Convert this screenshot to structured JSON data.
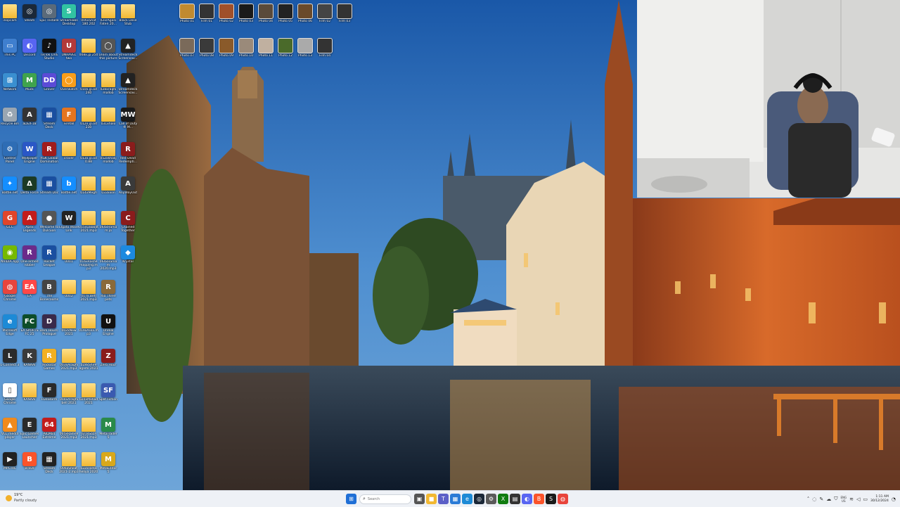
{
  "desktop": {
    "columns": [
      [
        {
          "label": "inopcam",
          "kind": "folder"
        },
        {
          "label": "This PC",
          "kind": "app",
          "color": "#3f7fcf",
          "glyph": "▭"
        },
        {
          "label": "Network",
          "kind": "app",
          "color": "#3a8fd0",
          "glyph": "⊞"
        },
        {
          "label": "Recycle Bin",
          "kind": "app",
          "color": "#9aa6b2",
          "glyph": "♻"
        },
        {
          "label": "Control Panel",
          "kind": "app",
          "color": "#2e6db5",
          "glyph": "⚙"
        },
        {
          "label": "Battle.net",
          "kind": "app",
          "color": "#148eff",
          "glyph": "✦"
        },
        {
          "label": "GCC",
          "kind": "app",
          "color": "#e0452a",
          "glyph": "G"
        },
        {
          "label": "NVIDIA App",
          "kind": "app",
          "color": "#76b900",
          "glyph": "◉"
        },
        {
          "label": "Google Chrome",
          "kind": "app",
          "color": "#e8453c",
          "glyph": "◍"
        },
        {
          "label": "Microsoft Edge",
          "kind": "app",
          "color": "#1d8ad6",
          "glyph": "e"
        },
        {
          "label": "L-Connect 3",
          "kind": "app",
          "color": "#2b2b2b",
          "glyph": "L"
        },
        {
          "label": "Google Chrome",
          "kind": "app",
          "color": "#ffffff",
          "glyph": "▯"
        },
        {
          "label": "VLC media player",
          "kind": "app",
          "color": "#f08a1c",
          "glyph": "▲"
        },
        {
          "label": "MPC-HC",
          "kind": "app",
          "color": "#222222",
          "glyph": "▶"
        }
      ],
      [
        {
          "label": "Steam",
          "kind": "app",
          "color": "#1b2838",
          "glyph": "◎"
        },
        {
          "label": "Discord",
          "kind": "app",
          "color": "#5865f2",
          "glyph": "◐"
        },
        {
          "label": "Muck",
          "kind": "app",
          "color": "#3fa34d",
          "glyph": "M"
        },
        {
          "label": "aDEX-18",
          "kind": "app",
          "color": "#333333",
          "glyph": "A"
        },
        {
          "label": "Wallpaper Engine",
          "kind": "app",
          "color": "#2a57c6",
          "glyph": "W"
        },
        {
          "label": "Delta Force",
          "kind": "app",
          "color": "#1c3a25",
          "glyph": "Δ"
        },
        {
          "label": "Apex Legends",
          "kind": "app",
          "color": "#c21c1c",
          "glyph": "A"
        },
        {
          "label": "One-armed robber",
          "kind": "app",
          "color": "#6b2b8a",
          "glyph": "R"
        },
        {
          "label": "EA",
          "kind": "app",
          "color": "#ff4747",
          "glyph": "EA"
        },
        {
          "label": "EA SPORTS FC 25",
          "kind": "app",
          "color": "#0d4d2a",
          "glyph": "FC"
        },
        {
          "label": "KANAAI",
          "kind": "app",
          "color": "#3a3a3a",
          "glyph": "K"
        },
        {
          "label": "KANAAI",
          "kind": "folder"
        },
        {
          "label": "Epic Games Launcher",
          "kind": "app",
          "color": "#2a2a2a",
          "glyph": "E"
        },
        {
          "label": "Brave",
          "kind": "app",
          "color": "#fb542b",
          "glyph": "B"
        }
      ],
      [
        {
          "label": "Epic Installe",
          "kind": "app",
          "color": "#5a6a7a",
          "glyph": "◎"
        },
        {
          "label": "TikTok LIVE Studio",
          "kind": "app",
          "color": "#111111",
          "glyph": "♪"
        },
        {
          "label": "Grover",
          "kind": "app",
          "color": "#5b4bd6",
          "glyph": "DD"
        },
        {
          "label": "Stream Deck",
          "kind": "app",
          "color": "#1a4fa0",
          "glyph": "▦"
        },
        {
          "label": "RGK Global Domination",
          "kind": "app",
          "color": "#a01c1c",
          "glyph": "R"
        },
        {
          "label": "Stream Doc",
          "kind": "app",
          "color": "#1a4fa0",
          "glyph": "▦"
        },
        {
          "label": "Welcome to Dulcuon",
          "kind": "app",
          "color": "#555555",
          "glyph": "●"
        },
        {
          "label": "Rocket League",
          "kind": "app",
          "color": "#1a4fa0",
          "glyph": "R"
        },
        {
          "label": "The Bonecooms",
          "kind": "app",
          "color": "#444444",
          "glyph": "B"
        },
        {
          "label": "Dark Hours: Prologue",
          "kind": "app",
          "color": "#3a2a4a",
          "glyph": "D"
        },
        {
          "label": "Rockstar Games",
          "kind": "app",
          "color": "#f2b022",
          "glyph": "R"
        },
        {
          "label": "FiveStorm",
          "kind": "app",
          "color": "#2a2a2a",
          "glyph": "F"
        },
        {
          "label": "AIDA64 Extreme",
          "kind": "app",
          "color": "#c21c1c",
          "glyph": "64"
        },
        {
          "label": "Stream Deck",
          "kind": "app",
          "color": "#222222",
          "glyph": "▦"
        }
      ],
      [
        {
          "label": "Streamlabs Desktop",
          "kind": "app",
          "color": "#31c3a2",
          "glyph": "S"
        },
        {
          "label": "UNRAVEL two",
          "kind": "app",
          "color": "#b23a3a",
          "glyph": "U"
        },
        {
          "label": "Overwatch",
          "kind": "app",
          "color": "#f99e1a",
          "glyph": "◯"
        },
        {
          "label": "Firefall",
          "kind": "app",
          "color": "#e57520",
          "glyph": "F"
        },
        {
          "label": "crover",
          "kind": "folder"
        },
        {
          "label": "Battle.net",
          "kind": "app",
          "color": "#148eff",
          "glyph": "b"
        },
        {
          "label": "Elgato Wave Link",
          "kind": "app",
          "color": "#222222",
          "glyph": "W"
        },
        {
          "label": "0001",
          "kind": "folder"
        },
        {
          "label": "0002",
          "kind": "folder"
        },
        {
          "label": "002xNew 2021",
          "kind": "folder"
        },
        {
          "label": "003xAraghi 2021.mp3",
          "kind": "folder"
        },
        {
          "label": "004xAraghi bell 2021",
          "kind": "folder"
        },
        {
          "label": "005xRamse 2021.mp3",
          "kind": "folder"
        },
        {
          "label": "006xShilat 2021-2.mp3",
          "kind": "folder"
        }
      ],
      [
        {
          "label": "006xShat 180.202",
          "kind": "folder"
        },
        {
          "label": "008x.jp 250",
          "kind": "folder"
        },
        {
          "label": "010x.jp.od 240",
          "kind": "folder"
        },
        {
          "label": "012x.jp.od 230",
          "kind": "folder"
        },
        {
          "label": "013x.jp.od 0.88",
          "kind": "folder"
        },
        {
          "label": "014xMegh",
          "kind": "folder"
        },
        {
          "label": "015xDabbat 2021.mp3",
          "kind": "folder"
        },
        {
          "label": "016xRashe mapping.mp3",
          "kind": "folder"
        },
        {
          "label": "017x.Beti 2021.mp3",
          "kind": "folder"
        },
        {
          "label": "019xAsila.mp3",
          "kind": "folder"
        },
        {
          "label": "019xShire agami 2021",
          "kind": "folder"
        },
        {
          "label": "020xMahad 2021",
          "kind": "folder"
        },
        {
          "label": "021xSoza 2021.mp3",
          "kind": "folder"
        },
        {
          "label": "022xFarka heliya 2020",
          "kind": "folder"
        }
      ],
      [
        {
          "label": "02xrAgani Faten 20...",
          "kind": "folder"
        },
        {
          "label": "Learn about this picture",
          "kind": "app",
          "color": "#555555",
          "glyph": "◯"
        },
        {
          "label": "028xraghi mallob",
          "kind": "folder"
        },
        {
          "label": "031xhalo",
          "kind": "folder"
        },
        {
          "label": "052xkhalij mallob",
          "kind": "folder"
        },
        {
          "label": "033xxon",
          "kind": "folder"
        },
        {
          "label": "064xHamam jo",
          "kind": "folder"
        },
        {
          "label": "064xHamam 2020.mp3",
          "kind": "folder"
        },
        {
          "label": "Rio Three pets",
          "kind": "app",
          "color": "#8a6a3a",
          "glyph": "R"
        },
        {
          "label": "Unreal Engine",
          "kind": "app",
          "color": "#111111",
          "glyph": "U"
        },
        {
          "label": "Zero Hour",
          "kind": "app",
          "color": "#8a1c1c",
          "glyph": "Z"
        },
        {
          "label": "Split Fiction",
          "kind": "app",
          "color": "#3a5ab0",
          "glyph": "SF"
        },
        {
          "label": "MetaTrader 5",
          "kind": "app",
          "color": "#2a8a4a",
          "glyph": "M"
        },
        {
          "label": "MetaEditor 5",
          "kind": "app",
          "color": "#d8a81c",
          "glyph": "M"
        }
      ],
      [
        {
          "label": "Black Dese Stub",
          "kind": "folder"
        },
        {
          "label": "Streamdeck Screensav...",
          "kind": "app",
          "color": "#222222",
          "glyph": "▲"
        },
        {
          "label": "Streamdeck Screensav...",
          "kind": "app",
          "color": "#222222",
          "glyph": "▲"
        },
        {
          "label": "Call of Duty ® M...",
          "kind": "app",
          "color": "#1a1a1a",
          "glyph": "MW"
        },
        {
          "label": "Red Dead Redempti...",
          "kind": "app",
          "color": "#8a1c1c",
          "glyph": "R"
        },
        {
          "label": "AnyWayOut",
          "kind": "app",
          "color": "#3a3a3a",
          "glyph": "A"
        },
        {
          "label": "Chained Together",
          "kind": "app",
          "color": "#8a1c1c",
          "glyph": "C"
        },
        {
          "label": "Krystal",
          "kind": "app",
          "color": "#1c8ae0",
          "glyph": "◆"
        }
      ]
    ],
    "top_row_1": [
      {
        "label": "Photo 01",
        "color": "#c08a30"
      },
      {
        "label": "Film 01",
        "color": "#333333"
      },
      {
        "label": "Photo 02",
        "color": "#a0502a"
      },
      {
        "label": "Photo 03",
        "color": "#1a1a1a"
      },
      {
        "label": "Photo 04",
        "color": "#5a4a3a"
      },
      {
        "label": "Photo 05",
        "color": "#222222"
      },
      {
        "label": "Photo 06",
        "color": "#6a4a2a"
      },
      {
        "label": "Film 02",
        "color": "#444444"
      },
      {
        "label": "Film 03",
        "color": "#333333"
      }
    ],
    "top_row_2": [
      {
        "label": "Photo 07",
        "color": "#7a6a5a"
      },
      {
        "label": "Photo 08",
        "color": "#3a3a3a"
      },
      {
        "label": "Photo 09",
        "color": "#8a5a2a"
      },
      {
        "label": "Photo 10",
        "color": "#9a8a7a"
      },
      {
        "label": "Photo 11",
        "color": "#c0b0a0"
      },
      {
        "label": "Photo 12",
        "color": "#4a6a2a"
      },
      {
        "label": "Photo 13",
        "color": "#aaaaaa"
      },
      {
        "label": "Film 04",
        "color": "#333333"
      }
    ]
  },
  "taskbar": {
    "weather_temp": "19°C",
    "weather_cond": "Partly cloudy",
    "search_placeholder": "Search",
    "pinned": [
      {
        "name": "start-button",
        "glyph": "⊞",
        "color": "#1f6fd6"
      },
      {
        "name": "task-view-button",
        "glyph": "▣",
        "color": "#555555"
      },
      {
        "name": "file-explorer-button",
        "glyph": "■",
        "color": "#f2b832"
      },
      {
        "name": "teams-button",
        "glyph": "T",
        "color": "#5b5fc7"
      },
      {
        "name": "store-button",
        "glyph": "▦",
        "color": "#2b7bd6"
      },
      {
        "name": "edge-button",
        "glyph": "e",
        "color": "#1d8ad6"
      },
      {
        "name": "steam-button",
        "glyph": "◎",
        "color": "#1b2838"
      },
      {
        "name": "settings-button",
        "glyph": "⚙",
        "color": "#5a5a5a"
      },
      {
        "name": "xbox-button",
        "glyph": "X",
        "color": "#107c10"
      },
      {
        "name": "notepad-button",
        "glyph": "▤",
        "color": "#333333"
      },
      {
        "name": "discord-button",
        "glyph": "◐",
        "color": "#5865f2"
      },
      {
        "name": "brave-button",
        "glyph": "B",
        "color": "#fb542b"
      },
      {
        "name": "streamlabs-button",
        "glyph": "S",
        "color": "#1a1a1a"
      },
      {
        "name": "chrome-button",
        "glyph": "◍",
        "color": "#e8453c"
      }
    ],
    "lang_top": "ENG",
    "lang_bottom": "US",
    "time": "1:11 AM",
    "date": "30/12/2024"
  }
}
